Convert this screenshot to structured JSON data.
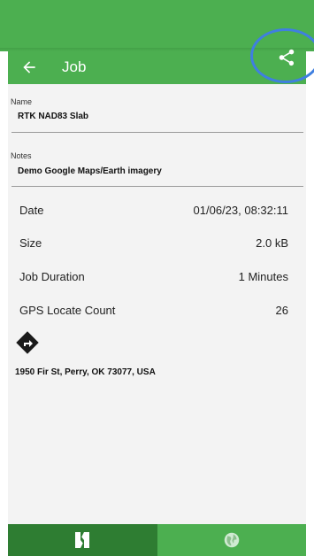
{
  "app_bar": {
    "title": "Job",
    "back_icon": "arrow-left-icon",
    "share_icon": "share-icon"
  },
  "colors": {
    "primary": "#4caf50",
    "primary_dark": "#2e7d32",
    "highlight": "#3f7fe0"
  },
  "fields": {
    "name_label": "Name",
    "name_value": "RTK NAD83 Slab",
    "notes_label": "Notes",
    "notes_value": "Demo Google Maps/Earth imagery"
  },
  "details": [
    {
      "label": "Date",
      "value": "01/06/23, 08:32:11"
    },
    {
      "label": "Size",
      "value": "2.0 kB"
    },
    {
      "label": "Job Duration",
      "value": "1 Minutes"
    },
    {
      "label": "GPS Locate Count",
      "value": "26"
    }
  ],
  "location": {
    "icon": "directions-icon",
    "address": "1950 Fir St, Perry, OK 73077, USA"
  },
  "bottom_nav": [
    {
      "icon": "job-icon",
      "selected": true
    },
    {
      "icon": "globe-icon",
      "selected": false
    }
  ]
}
